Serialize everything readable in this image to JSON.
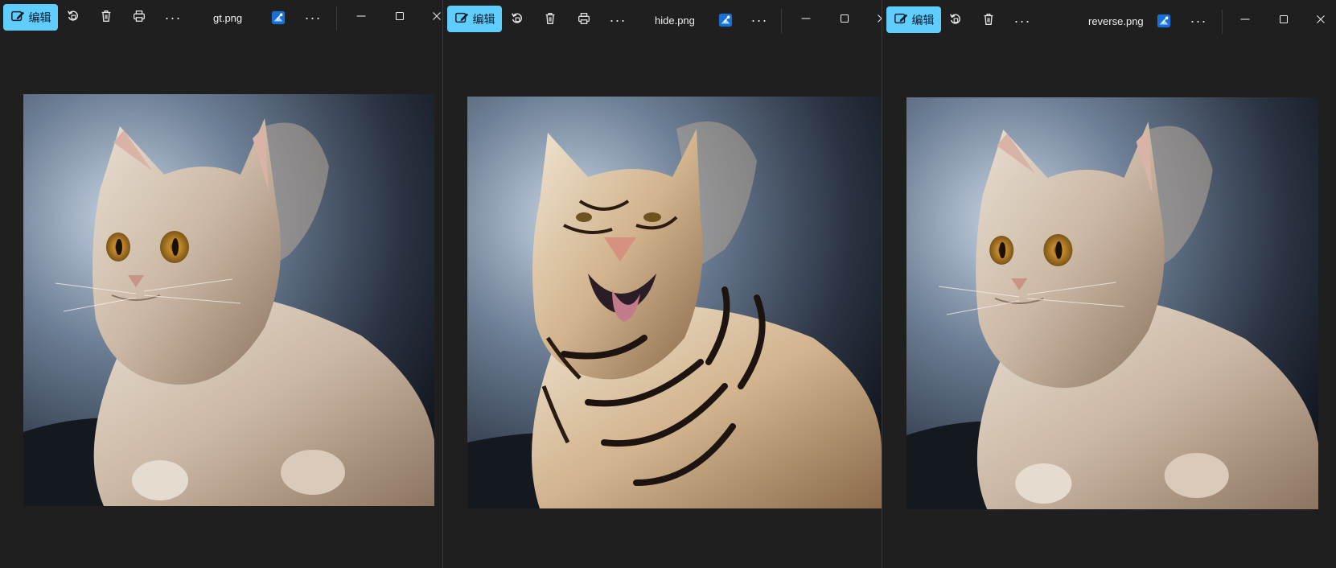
{
  "windows": [
    {
      "id": "w1",
      "edit_label": "编辑",
      "filename": "gt.png",
      "has_print": true,
      "subject": "cat"
    },
    {
      "id": "w2",
      "edit_label": "编辑",
      "filename": "hide.png",
      "has_print": true,
      "subject": "tiger"
    },
    {
      "id": "w3",
      "edit_label": "编辑",
      "filename": "reverse.png",
      "has_print": false,
      "subject": "cat"
    }
  ],
  "colors": {
    "background": "#1f1f1f",
    "accent": "#60cdff",
    "text": "#f0f0f0"
  },
  "icons": [
    "edit-icon",
    "rotate-icon",
    "delete-icon",
    "print-icon",
    "more-icon",
    "photos-brand-icon",
    "minimize-icon",
    "maximize-icon",
    "close-icon"
  ]
}
